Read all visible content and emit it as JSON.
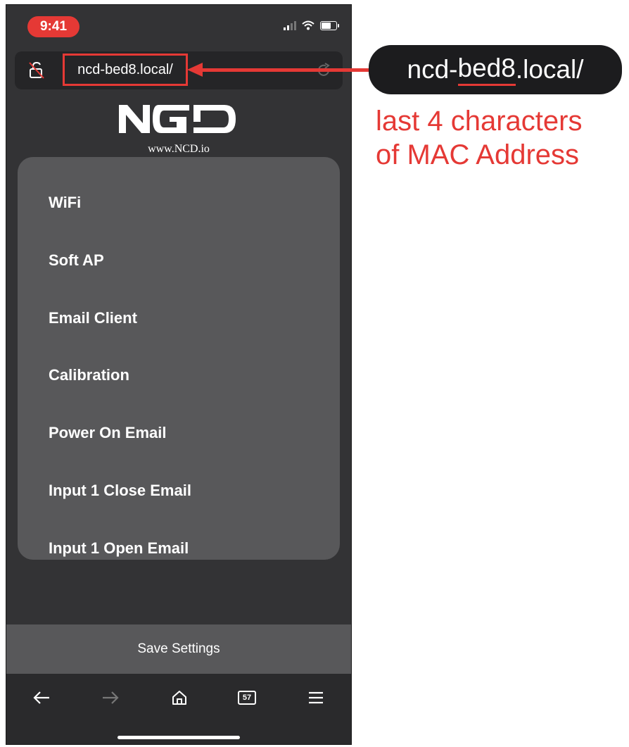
{
  "status_bar": {
    "time": "9:41"
  },
  "browser": {
    "url": "ncd-bed8.local/",
    "tab_count": "57"
  },
  "logo": {
    "alt": "NCD",
    "subtitle": "www.NCD.io"
  },
  "menu": {
    "items": [
      {
        "label": "WiFi"
      },
      {
        "label": "Soft AP"
      },
      {
        "label": "Email Client"
      },
      {
        "label": "Calibration"
      },
      {
        "label": "Power On Email"
      },
      {
        "label": "Input 1 Close Email"
      },
      {
        "label": "Input 1 Open Email"
      }
    ]
  },
  "save": {
    "label": "Save Settings"
  },
  "annotation": {
    "url_prefix": "ncd-",
    "url_highlight": "bed8",
    "url_suffix": ".local/",
    "note_line1": "last 4 characters",
    "note_line2": "of MAC Address",
    "accent": "#e53935"
  }
}
